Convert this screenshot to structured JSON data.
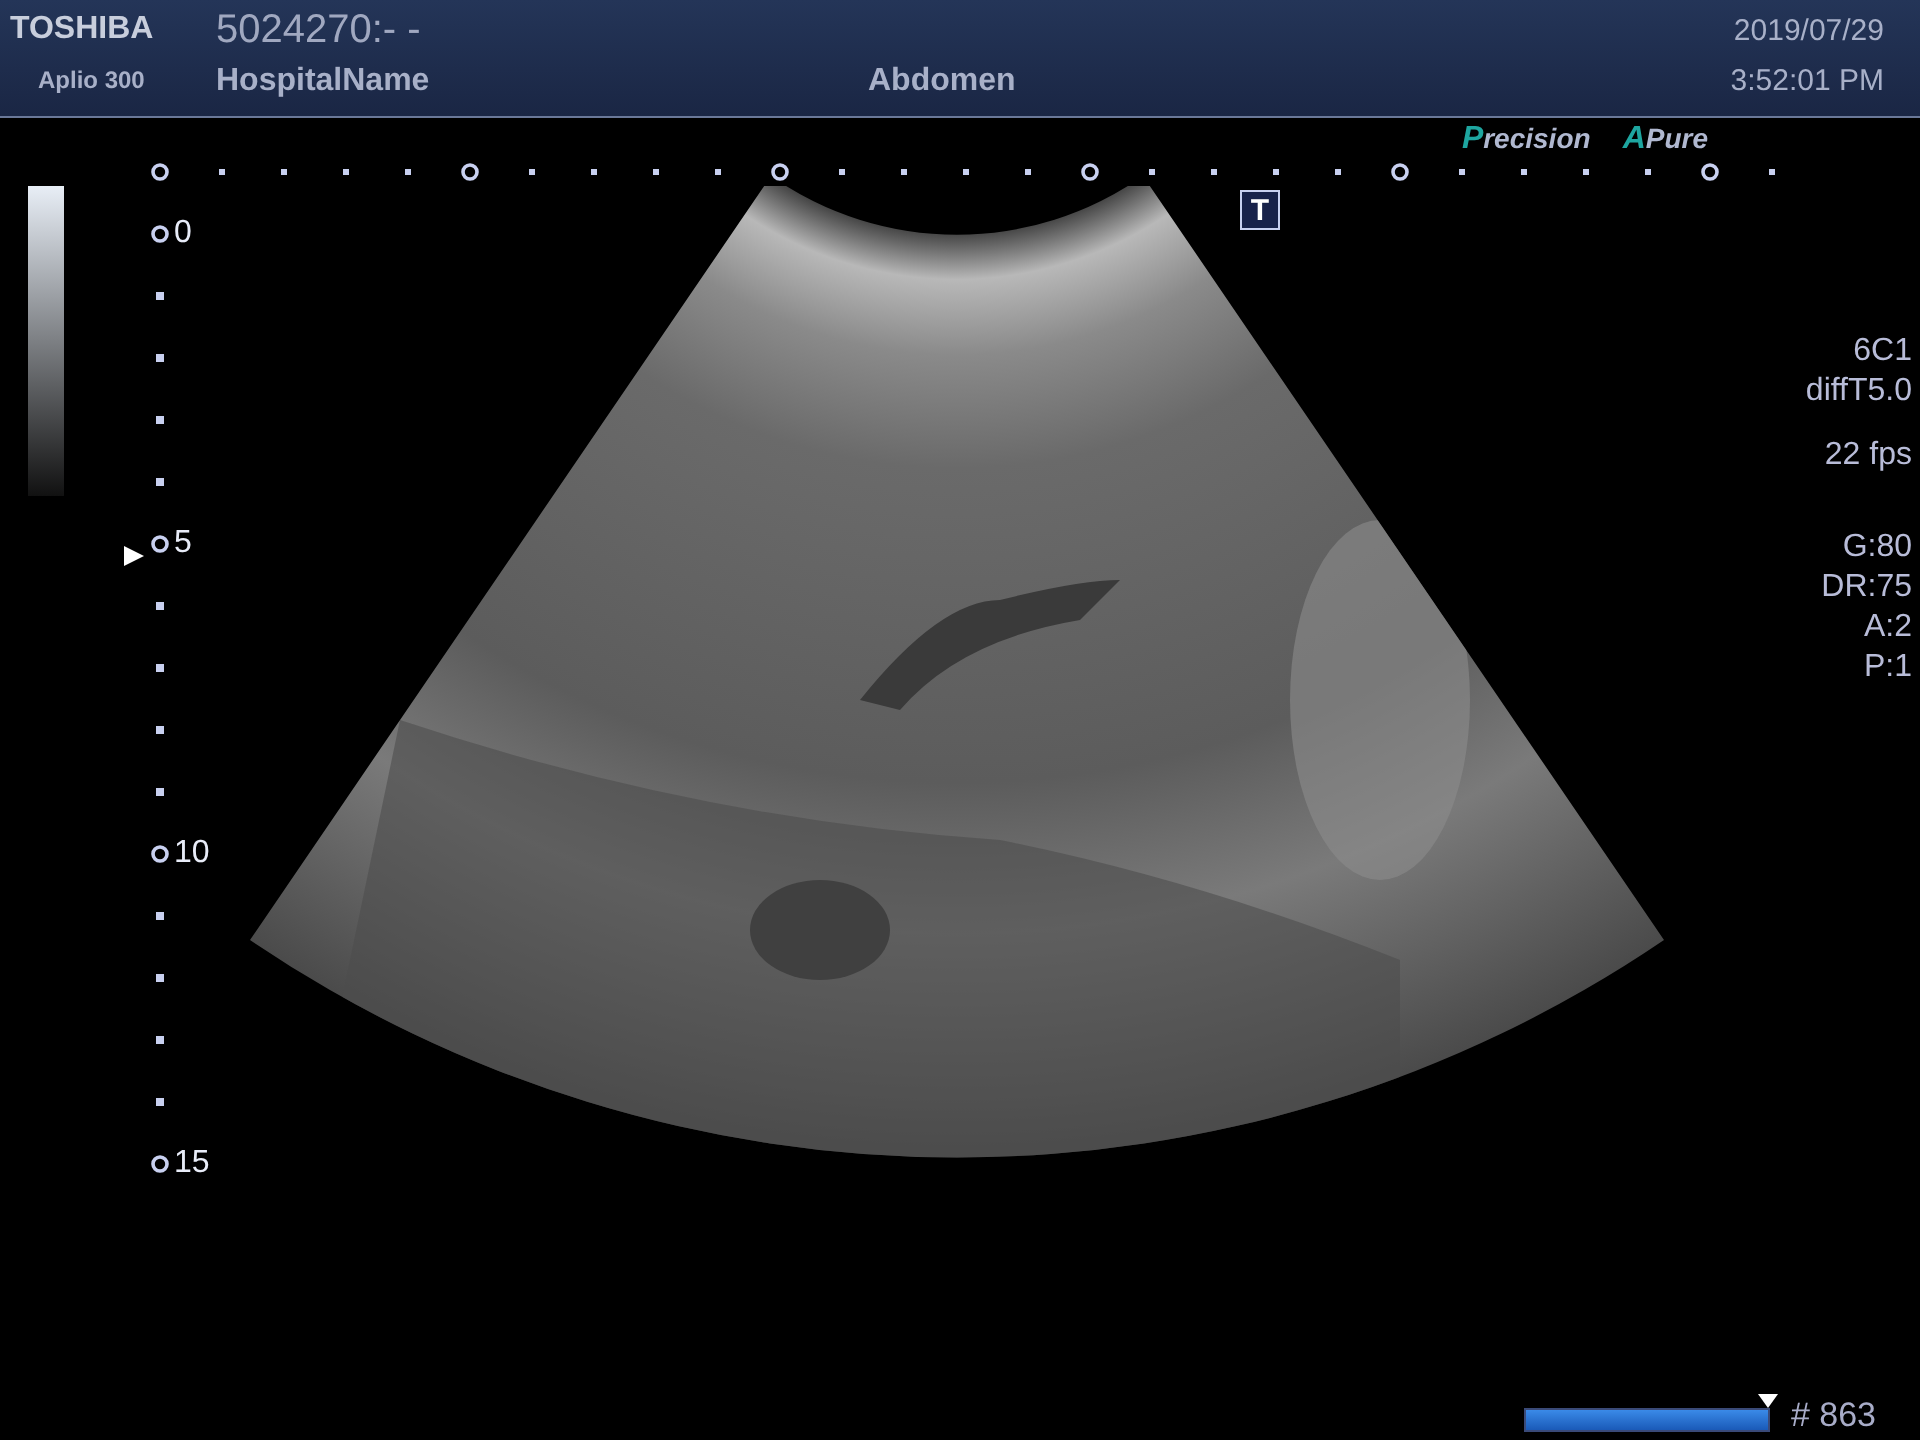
{
  "header": {
    "brand": "TOSHIBA",
    "model": "Aplio 300",
    "patient_id": "5024270:- -",
    "hospital": "HospitalName",
    "exam": "Abdomen",
    "date": "2019/07/29",
    "time": "3:52:01 PM"
  },
  "modes": [
    "Precision",
    "APure"
  ],
  "depth_labels": [
    "0",
    "5",
    "10",
    "15"
  ],
  "params": [
    [
      "6C1",
      "diffT5.0"
    ],
    [
      "22 fps"
    ],
    [
      "G:80",
      "DR:75",
      "A:2",
      "P:1"
    ]
  ],
  "overlay_badge": "T",
  "cine": {
    "level": 1.0,
    "frame": "# 863"
  }
}
